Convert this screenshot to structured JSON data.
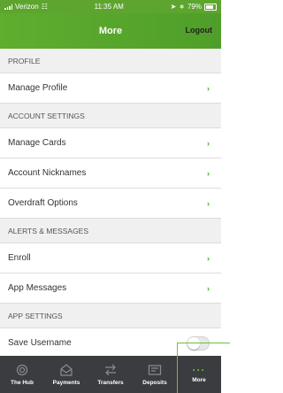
{
  "status": {
    "carrier": "Verizon",
    "time": "11:35 AM",
    "battery": "79%"
  },
  "nav": {
    "title": "More",
    "logout": "Logout"
  },
  "sections": {
    "profile": {
      "header": "PROFILE",
      "items": [
        "Manage Profile"
      ]
    },
    "account": {
      "header": "ACCOUNT SETTINGS",
      "items": [
        "Manage Cards",
        "Account Nicknames",
        "Overdraft Options"
      ]
    },
    "alerts": {
      "header": "ALERTS & MESSAGES",
      "items": [
        "Enroll",
        "App Messages"
      ]
    },
    "app": {
      "header": "APP SETTINGS",
      "items": [
        "Save Username"
      ]
    }
  },
  "tabs": [
    {
      "label": "The Hub",
      "icon": "hub-icon"
    },
    {
      "label": "Payments",
      "icon": "payments-icon"
    },
    {
      "label": "Transfers",
      "icon": "transfers-icon"
    },
    {
      "label": "Deposits",
      "icon": "deposits-icon"
    },
    {
      "label": "More",
      "icon": "more-icon"
    }
  ],
  "colors": {
    "brand": "#5da52e",
    "tabbar": "#3a3c40",
    "accent": "#6ec03a"
  }
}
